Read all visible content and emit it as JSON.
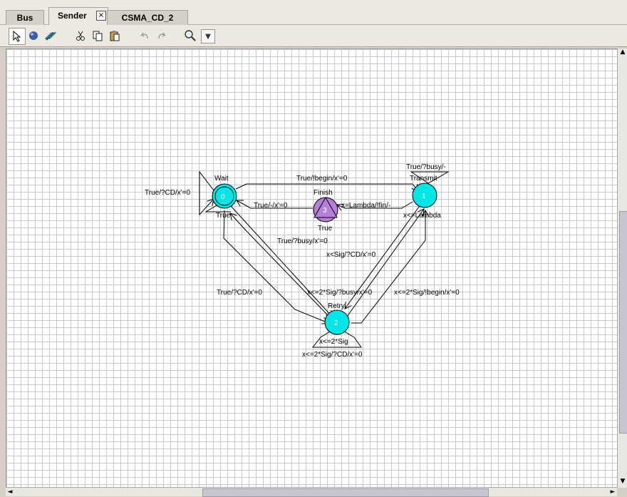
{
  "tabs": {
    "bus": "Bus",
    "sender": "Sender",
    "csma": "CSMA_CD_2"
  },
  "toolbar": {
    "icons": [
      "pointer-icon",
      "location-icon",
      "edge-icon",
      "cut-icon",
      "copy-icon",
      "paste-icon",
      "undo-icon",
      "redo-icon",
      "zoom-icon",
      "dropdown-icon"
    ]
  },
  "automaton": {
    "locations": [
      {
        "id": "0",
        "name": "Wait",
        "invariant": "True"
      },
      {
        "id": "1",
        "name": "Transmit",
        "invariant": "x<=Lambda"
      },
      {
        "id": "2",
        "name": "Retry",
        "invariant": "x<=2*Sig"
      },
      {
        "id": "3",
        "name": "Finish",
        "invariant": "True"
      }
    ],
    "edge_labels": {
      "wait_self": "True/?CD/x'=0",
      "wait_to_transmit": "True/!begin/x'=0",
      "finish_to_wait": "True/-/x'=0",
      "transmit_to_finish": "x=Lambda/!fin/-",
      "transmit_self": "True/?busy/-",
      "wait_to_retry_busy": "True/?busy/x'=0",
      "transmit_to_retry_cd": "x<Sig/?CD/x'=0",
      "wait_to_retry_cd": "True/?CD/x'=0",
      "retry_to_wait_busy": "x<=2*Sig/?busy/x'=0",
      "retry_to_transmit": "x<=2*Sig/!begin/x'=0",
      "retry_self": "x<=2*Sig/?CD/x'=0"
    },
    "colors": {
      "location": "#00e5e5",
      "committed": "#b480d8",
      "grid": "#c8c8c8"
    }
  }
}
